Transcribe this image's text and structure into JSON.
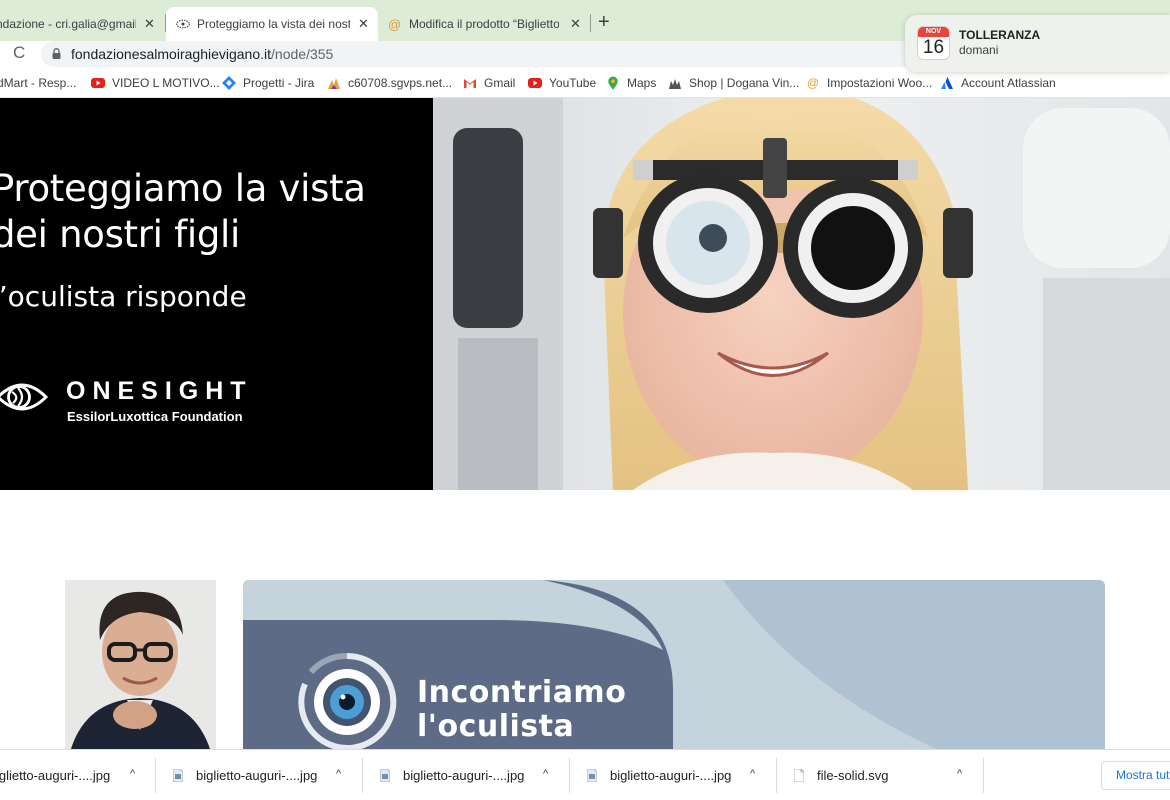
{
  "tabs": [
    {
      "title": "ndazione - cri.galia@gmail.c",
      "close": "✕",
      "active": false
    },
    {
      "title": "Proteggiamo la vista dei nostri",
      "close": "✕",
      "active": true
    },
    {
      "title": "Modifica il prodotto “Biglietto a",
      "close": "✕",
      "active": false
    }
  ],
  "new_tab": "+",
  "address": {
    "host": "fondazionesalmoiraghievigano.it",
    "path": "/node/355"
  },
  "bookmarks": [
    {
      "label": "dMart - Resp...",
      "icon": "none"
    },
    {
      "label": "VIDEO L MOTIVO...",
      "icon": "youtube-icon"
    },
    {
      "label": "Progetti - Jira",
      "icon": "jira-icon"
    },
    {
      "label": "c60708.sgvps.net...",
      "icon": "siteground-icon"
    },
    {
      "label": "Gmail",
      "icon": "gmail-icon"
    },
    {
      "label": "YouTube",
      "icon": "youtube-icon"
    },
    {
      "label": "Maps",
      "icon": "maps-icon"
    },
    {
      "label": "Shop | Dogana Vin...",
      "icon": "shop-icon"
    },
    {
      "label": "Impostazioni Woo...",
      "icon": "woo-icon"
    },
    {
      "label": "Account Atlassian",
      "icon": "atlassian-icon"
    }
  ],
  "notification": {
    "month": "NOV",
    "day": "16",
    "title": "TOLLERANZA",
    "subtitle": "domani"
  },
  "hero": {
    "title_line1": "Proteggiamo la vista",
    "title_line2": "dei nostri figli",
    "subtitle": "l’oculista risponde",
    "brand_name": "ONESIGHT",
    "brand_sub": "EssilorLuxottica Foundation"
  },
  "banner": {
    "line1": "Incontriamo",
    "line2": "l'oculista"
  },
  "downloads": [
    {
      "name": "iglietto-auguri-....jpg",
      "type": "image"
    },
    {
      "name": "biglietto-auguri-....jpg",
      "type": "image"
    },
    {
      "name": "biglietto-auguri-....jpg",
      "type": "image"
    },
    {
      "name": "biglietto-auguri-....jpg",
      "type": "image"
    },
    {
      "name": "file-solid.svg",
      "type": "file"
    }
  ],
  "chevron": "^",
  "show_all": "Mostra tutti",
  "colors": {
    "tabstrip": "#dcecd6",
    "accent": "#1a73e8",
    "hero_bg": "#000000",
    "banner_bg": "#c7d4de",
    "banner_shape": "#5b6b88"
  }
}
